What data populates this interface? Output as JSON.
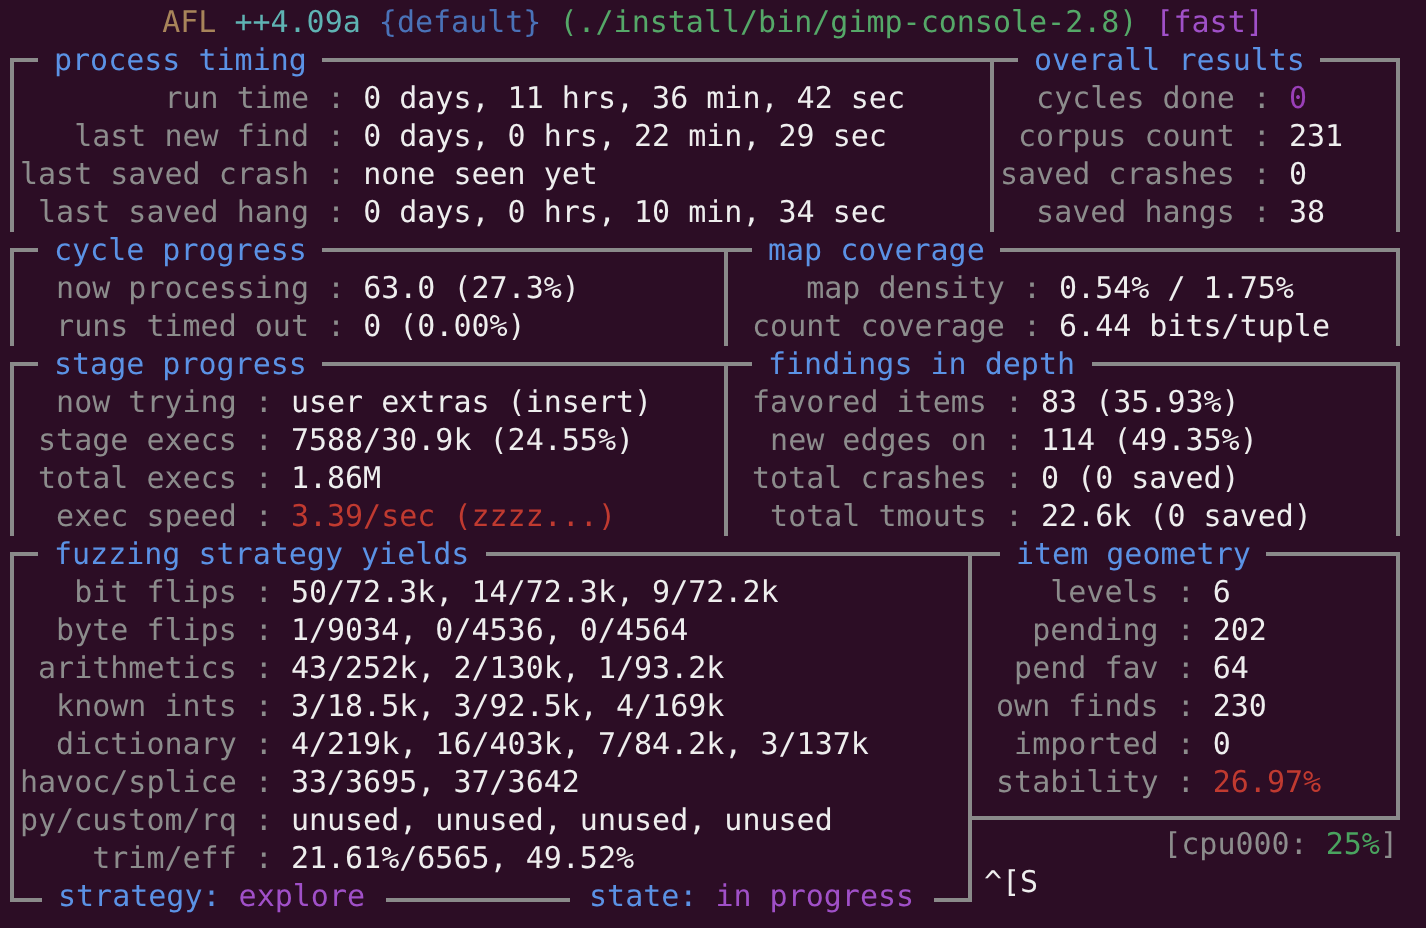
{
  "title": [
    {
      "text": "AFL",
      "color": "#a8845a"
    },
    {
      "text": "++4.09a",
      "color": "#5fb3b3"
    },
    {
      "text": "{default}",
      "color": "#4a72b8"
    },
    {
      "text": "(./install/bin/gimp-console-2.8)",
      "color": "#55a868"
    },
    {
      "text": "[fast]",
      "color": "#a050c8"
    }
  ],
  "sections": [
    {
      "title": "process timing",
      "rows": [
        {
          "label": "run time :",
          "value": "0 days, 11 hrs, 36 min, 42 sec"
        },
        {
          "label": "last new find :",
          "value": "0 days, 0 hrs, 22 min, 29 sec"
        },
        {
          "label": "last saved crash :",
          "value": "none seen yet"
        },
        {
          "label": "last saved hang :",
          "value": "0 days, 0 hrs, 10 min, 34 sec"
        }
      ]
    },
    {
      "title": "overall results",
      "rows": [
        {
          "label": "cycles done :",
          "value": "0",
          "color": "#9a3fb8"
        },
        {
          "label": "corpus count :",
          "value": "231"
        },
        {
          "label": "saved crashes :",
          "value": "0"
        },
        {
          "label": "saved hangs :",
          "value": "38"
        }
      ]
    },
    {
      "title": "cycle progress",
      "rows": [
        {
          "label": "now processing :",
          "value": "63.0 (27.3%)"
        },
        {
          "label": "runs timed out :",
          "value": "0 (0.00%)"
        }
      ]
    },
    {
      "title": "map coverage",
      "rows": [
        {
          "label": "map density :",
          "value": "0.54% / 1.75%"
        },
        {
          "label": "count coverage :",
          "value": "6.44 bits/tuple"
        }
      ]
    },
    {
      "title": "stage progress",
      "rows": [
        {
          "label": "now trying :",
          "value": "user extras (insert)"
        },
        {
          "label": "stage execs :",
          "value": "7588/30.9k (24.55%)"
        },
        {
          "label": "total execs :",
          "value": "1.86M"
        },
        {
          "label": "exec speed :",
          "value": "3.39/sec (zzzz...)",
          "color": "#c03a30"
        }
      ]
    },
    {
      "title": "findings in depth",
      "rows": [
        {
          "label": "favored items :",
          "value": "83 (35.93%)"
        },
        {
          "label": "new edges on :",
          "value": "114 (49.35%)"
        },
        {
          "label": "total crashes :",
          "value": "0 (0 saved)"
        },
        {
          "label": "total tmouts :",
          "value": "22.6k (0 saved)"
        }
      ]
    },
    {
      "title": "fuzzing strategy yields",
      "rows": [
        {
          "label": "bit flips :",
          "value": "50/72.3k, 14/72.3k, 9/72.2k"
        },
        {
          "label": "byte flips :",
          "value": "1/9034, 0/4536, 0/4564"
        },
        {
          "label": "arithmetics :",
          "value": "43/252k, 2/130k, 1/93.2k"
        },
        {
          "label": "known ints :",
          "value": "3/18.5k, 3/92.5k, 4/169k"
        },
        {
          "label": "dictionary :",
          "value": "4/219k, 16/403k, 7/84.2k, 3/137k"
        },
        {
          "label": "havoc/splice :",
          "value": "33/3695, 37/3642"
        },
        {
          "label": "py/custom/rq :",
          "value": "unused, unused, unused, unused"
        },
        {
          "label": "trim/eff :",
          "value": "21.61%/6565, 49.52%"
        }
      ]
    },
    {
      "title": "item geometry",
      "rows": [
        {
          "label": "levels :",
          "value": "6"
        },
        {
          "label": "pending :",
          "value": "202"
        },
        {
          "label": "pend fav :",
          "value": "64"
        },
        {
          "label": "own finds :",
          "value": "230"
        },
        {
          "label": "imported :",
          "value": "0"
        },
        {
          "label": "stability :",
          "value": "26.97%",
          "color": "#c03a30"
        }
      ]
    }
  ],
  "footer": {
    "strategy_label": "strategy:",
    "strategy": "explore",
    "state_label": "state:",
    "state": "in progress"
  },
  "cpu": {
    "prefix": "[cpu000:",
    "value": "25%",
    "suffix": "]"
  },
  "prompt": "^[S"
}
